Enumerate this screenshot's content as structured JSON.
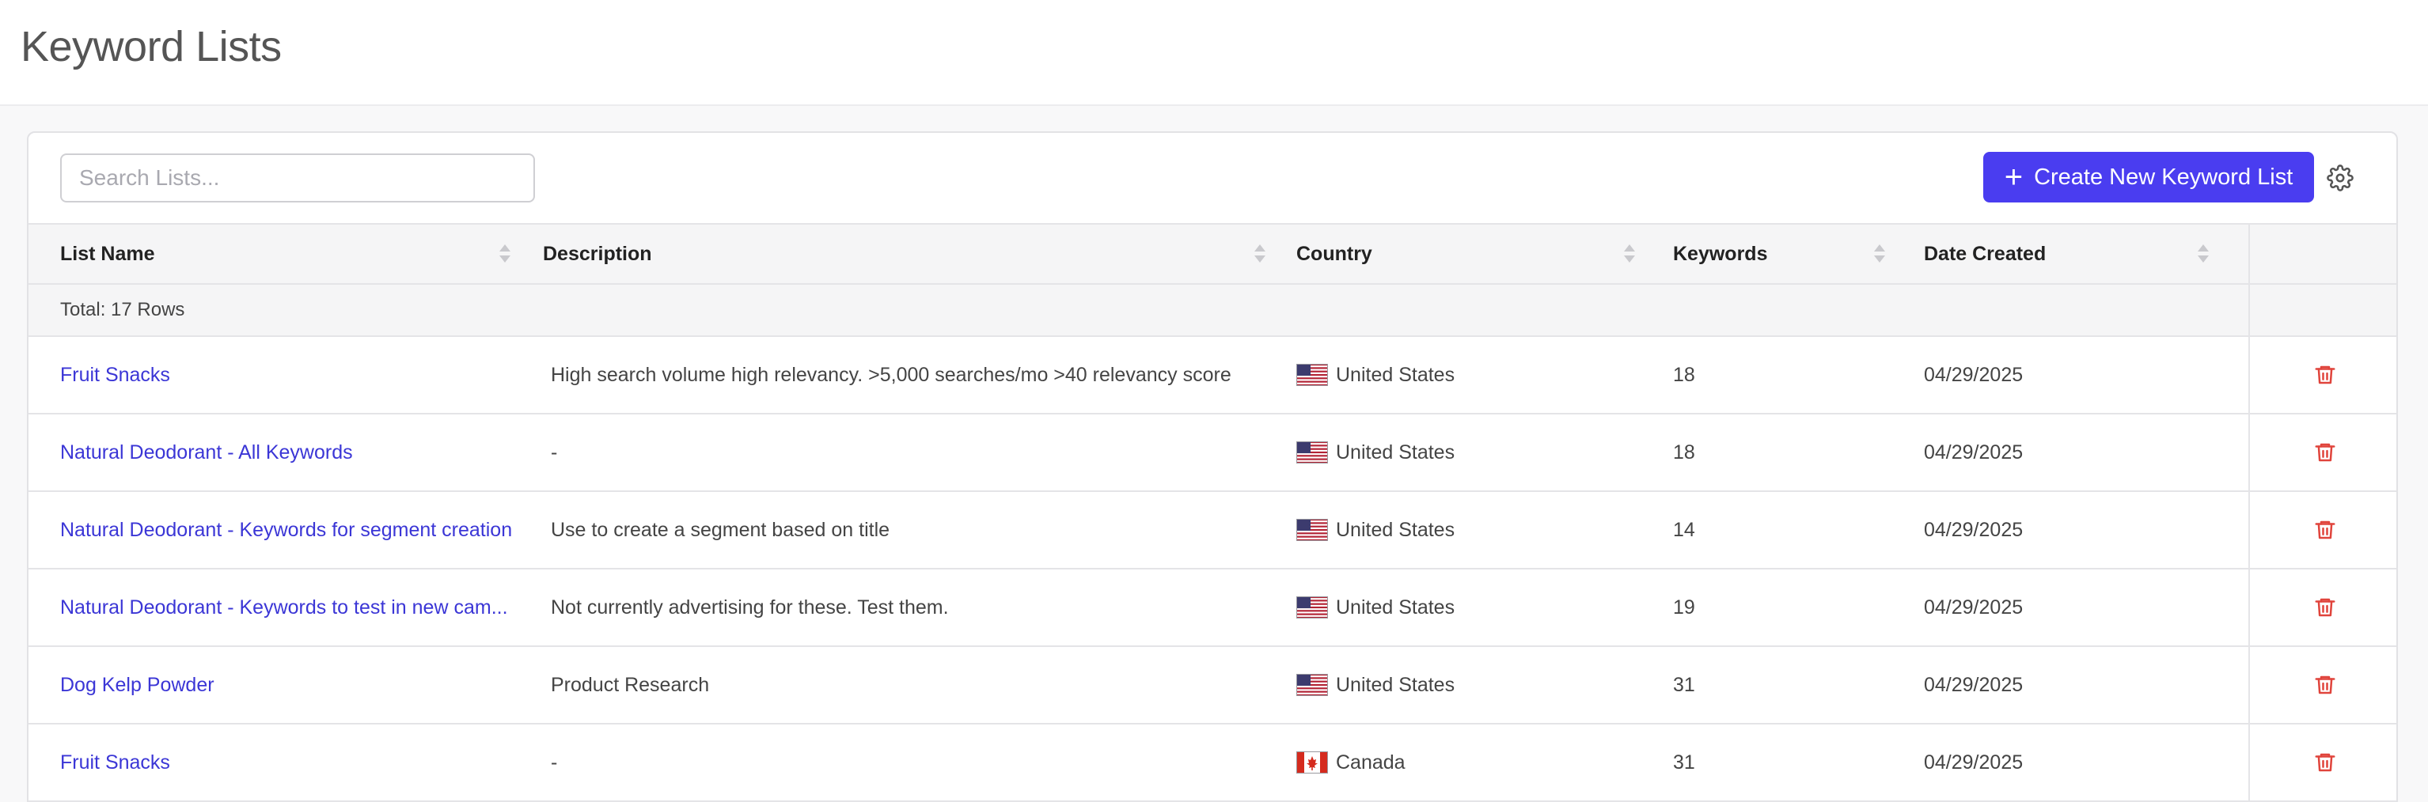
{
  "page": {
    "title": "Keyword Lists"
  },
  "toolbar": {
    "search_placeholder": "Search Lists...",
    "search_value": "",
    "create_button_label": "Create New Keyword List",
    "accent_color": "#4a3df0"
  },
  "table": {
    "columns": [
      "List Name",
      "Description",
      "Country",
      "Keywords",
      "Date Created"
    ],
    "total_label": "Total: 17 Rows",
    "rows": [
      {
        "name": "Fruit Snacks",
        "description": "High search volume high relevancy. >5,000 searches/mo >40 relevancy score",
        "country": "United States",
        "flag": "us-flag-icon",
        "keywords": "18",
        "date": "04/29/2025"
      },
      {
        "name": "Natural Deodorant - All Keywords",
        "description": "-",
        "country": "United States",
        "flag": "us-flag-icon",
        "keywords": "18",
        "date": "04/29/2025"
      },
      {
        "name": "Natural Deodorant - Keywords for segment creation",
        "description": "Use to create a segment based on title",
        "country": "United States",
        "flag": "us-flag-icon",
        "keywords": "14",
        "date": "04/29/2025"
      },
      {
        "name": "Natural Deodorant - Keywords to test in new cam...",
        "description": "Not currently advertising for these. Test them.",
        "country": "United States",
        "flag": "us-flag-icon",
        "keywords": "19",
        "date": "04/29/2025"
      },
      {
        "name": "Dog Kelp Powder",
        "description": "Product Research",
        "country": "United States",
        "flag": "us-flag-icon",
        "keywords": "31",
        "date": "04/29/2025"
      },
      {
        "name": "Fruit Snacks",
        "description": "-",
        "country": "Canada",
        "flag": "ca-flag-icon",
        "keywords": "31",
        "date": "04/29/2025"
      }
    ]
  }
}
